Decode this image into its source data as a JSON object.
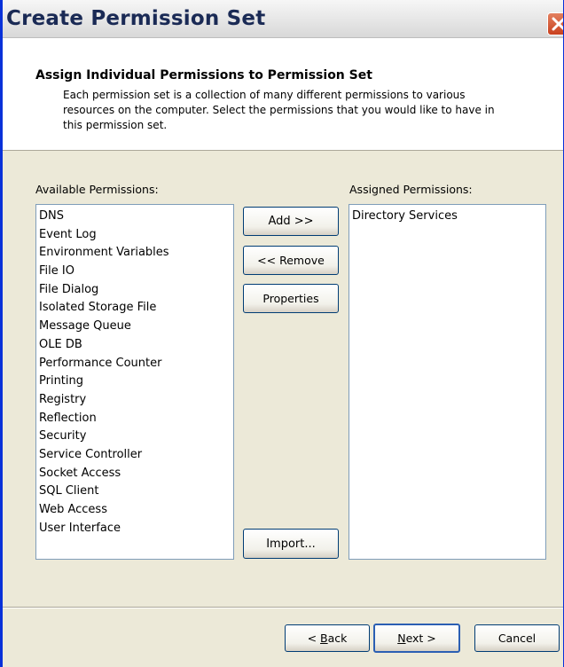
{
  "window": {
    "title": "Create Permission Set"
  },
  "header": {
    "title": "Assign Individual Permissions to Permission Set",
    "description": "Each permission set is a collection of many different permissions to various resources on the computer.  Select the permissions that you would like to have in this permission set."
  },
  "available": {
    "label": "Available Permissions:",
    "items": [
      "DNS",
      "Event Log",
      "Environment Variables",
      "File IO",
      "File Dialog",
      "Isolated Storage File",
      "Message Queue",
      "OLE DB",
      "Performance Counter",
      "Printing",
      "Registry",
      "Reflection",
      "Security",
      "Service Controller",
      "Socket Access",
      "SQL Client",
      "Web Access",
      "User Interface"
    ]
  },
  "assigned": {
    "label": "Assigned Permissions:",
    "items": [
      "Directory Services"
    ]
  },
  "buttons": {
    "add": "Add >>",
    "remove": "<< Remove",
    "properties": "Properties",
    "import": "Import...",
    "back_prefix": "< ",
    "back_mnemonic": "B",
    "back_rest": "ack",
    "next_mnemonic": "N",
    "next_rest": "ext >",
    "cancel": "Cancel"
  },
  "icons": {
    "close": "close-icon"
  },
  "colors": {
    "face": "#ece9d8",
    "title_text": "#1a2a55",
    "close_button": "#c9401e",
    "listbox_border": "#7f9db9",
    "button_border": "#003c74"
  }
}
